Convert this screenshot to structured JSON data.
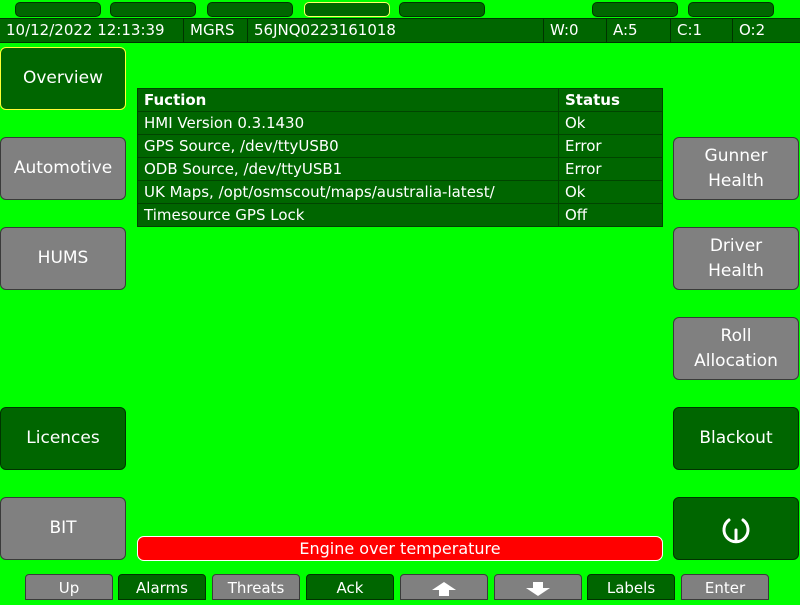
{
  "colors": {
    "background": "#00ff00",
    "panel_green": "#006600",
    "button_grey": "#808080",
    "alarm_red": "#ff0000",
    "highlight_yellow": "#ffff33"
  },
  "status_bar": {
    "datetime": "10/12/2022 12:13:39",
    "coord_system": "MGRS",
    "position": "56JNQ0223161018",
    "w": "W:0",
    "a": "A:5",
    "c": "C:1",
    "o": "O:2"
  },
  "left_buttons": [
    "Overview",
    "Automotive",
    "HUMS",
    "Licences",
    "BIT"
  ],
  "right_buttons": [
    "Gunner\nHealth",
    "Driver\nHealth",
    "Roll\nAllocation",
    "Blackout"
  ],
  "power_icon": "power-icon",
  "table": {
    "headers": [
      "Fuction",
      "Status"
    ],
    "rows": [
      [
        "HMI Version 0.3.1430",
        "Ok"
      ],
      [
        "GPS Source, /dev/ttyUSB0",
        "Error"
      ],
      [
        "ODB Source, /dev/ttyUSB1",
        "Error"
      ],
      [
        "UK Maps, /opt/osmscout/maps/australia-latest/",
        "Ok"
      ],
      [
        "Timesource GPS Lock",
        "Off"
      ]
    ]
  },
  "alarm": {
    "text": "Engine over temperature"
  },
  "bottom_buttons": {
    "up": "Up",
    "alarms": "Alarms",
    "threats": "Threats",
    "ack": "Ack",
    "up_arrow_icon": "arrow-up-icon",
    "down_arrow_icon": "arrow-down-icon",
    "labels": "Labels",
    "enter": "Enter"
  }
}
